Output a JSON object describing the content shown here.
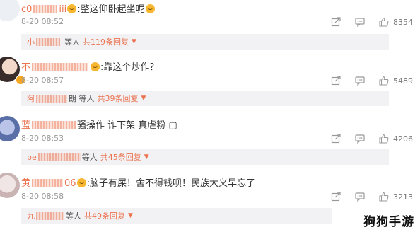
{
  "comments": [
    {
      "user_visible": "c0",
      "user_tail": "iii",
      "text": "整这仰卧起坐呢",
      "date": "8-20 08:52",
      "likes": "8354",
      "reply_prefix": "小",
      "reply_mid": "等人",
      "reply_count": "共119条回复"
    },
    {
      "user_visible": "不",
      "user_tail": "",
      "text": "靠这个炒作？",
      "date": "8-20 08:57",
      "likes": "5489",
      "reply_prefix": "阿",
      "reply_mid": "朗 等人",
      "reply_count": "共39条回复"
    },
    {
      "user_visible": "蓝",
      "user_tail": "",
      "text": "骚操作 诈下架 真虐粉 ▢",
      "date": "8-20 08:53",
      "likes": "4206",
      "reply_prefix": "pe",
      "reply_mid": "等人",
      "reply_count": "共45条回复"
    },
    {
      "user_visible": "黄",
      "user_tail": "06",
      "text": "脑子有屎！舍不得钱呗！民族大义早忘了",
      "date": "8-20 08:58",
      "likes": "3213",
      "reply_prefix": "九",
      "reply_mid": "等人",
      "reply_count": "共49条回复"
    }
  ],
  "icons": {
    "share": "share-icon",
    "comment": "comment-icon",
    "like": "thumbs-up-icon"
  },
  "watermark": "狗狗手游",
  "colors": {
    "accent": "#eb7350",
    "meta": "#999999",
    "reply_bg": "#f2f2f5"
  }
}
